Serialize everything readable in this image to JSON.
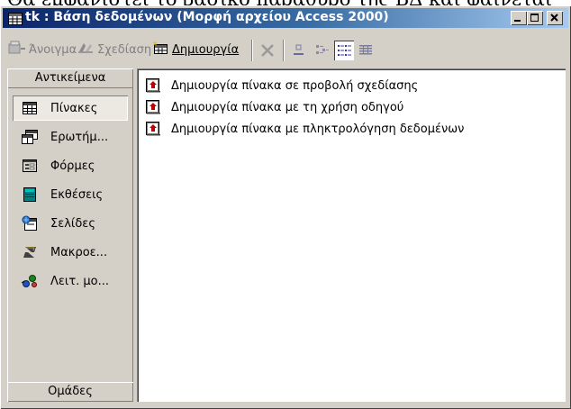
{
  "background_text": "Θα εμφανιστεί το βασικό παράθυρο της ΒΔ και φαίνεται",
  "window": {
    "title": "tk : Βάση δεδομένων (Μορφή αρχείου Access 2000)"
  },
  "toolbar": {
    "open_label": "Άνοιγμα",
    "design_label": "Σχεδίαση",
    "new_label": "Δημιουργία"
  },
  "objects_panel": {
    "header": "Αντικείμενα",
    "footer": "Ομάδες",
    "items": [
      {
        "label": "Πίνακες",
        "icon": "table-icon",
        "selected": true
      },
      {
        "label": "Ερωτήμ...",
        "icon": "query-icon",
        "selected": false
      },
      {
        "label": "Φόρμες",
        "icon": "form-icon",
        "selected": false
      },
      {
        "label": "Εκθέσεις",
        "icon": "report-icon",
        "selected": false
      },
      {
        "label": "Σελίδες",
        "icon": "page-icon",
        "selected": false
      },
      {
        "label": "Μακροε...",
        "icon": "macro-icon",
        "selected": false
      },
      {
        "label": "Λειτ. μο...",
        "icon": "module-icon",
        "selected": false
      }
    ]
  },
  "list": {
    "items": [
      "Δημιουργία πίνακα σε προβολή σχεδίασης",
      "Δημιουργία πίνακα με τη χρήση οδηγού",
      "Δημιουργία πίνακα με πληκτρολόγηση δεδομένων"
    ]
  },
  "colors": {
    "titlebar_start": "#0a246a",
    "titlebar_end": "#a6caf0",
    "face": "#d4d0c8"
  }
}
